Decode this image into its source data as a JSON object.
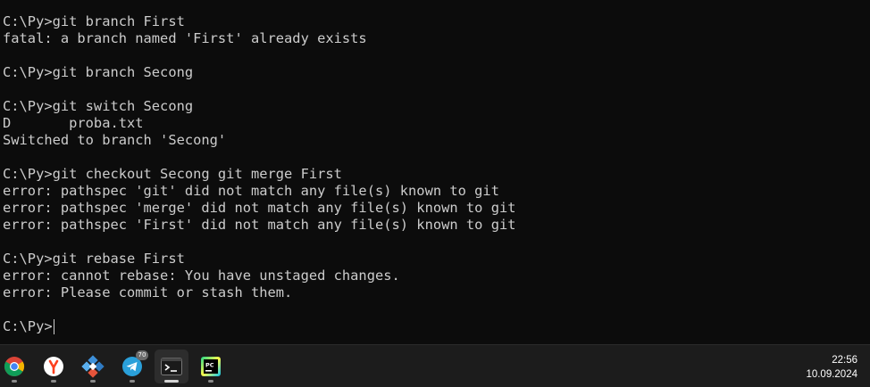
{
  "terminal": {
    "lines": [
      "C:\\Py>git branch First",
      "fatal: a branch named 'First' already exists",
      "",
      "C:\\Py>git branch Secong",
      "",
      "C:\\Py>git switch Secong",
      "D       proba.txt",
      "Switched to branch 'Secong'",
      "",
      "C:\\Py>git checkout Secong git merge First",
      "error: pathspec 'git' did not match any file(s) known to git",
      "error: pathspec 'merge' did not match any file(s) known to git",
      "error: pathspec 'First' did not match any file(s) known to git",
      "",
      "C:\\Py>git rebase First",
      "error: cannot rebase: You have unstaged changes.",
      "error: Please commit or stash them.",
      ""
    ],
    "prompt": "C:\\Py>"
  },
  "taskbar": {
    "apps": [
      {
        "icon": "chrome-icon"
      },
      {
        "icon": "yandex-browser-icon"
      },
      {
        "icon": "anydesk-icon"
      },
      {
        "icon": "telegram-icon",
        "badge": "70"
      },
      {
        "icon": "terminal-icon",
        "active": true
      },
      {
        "icon": "pycharm-icon",
        "label": "PC"
      }
    ],
    "clock": {
      "time": "22:56",
      "date": "10.09.2024"
    }
  },
  "colors": {
    "background": "#0c0c0c",
    "foreground": "#cccccc",
    "taskbar": "#1c1c1c"
  }
}
